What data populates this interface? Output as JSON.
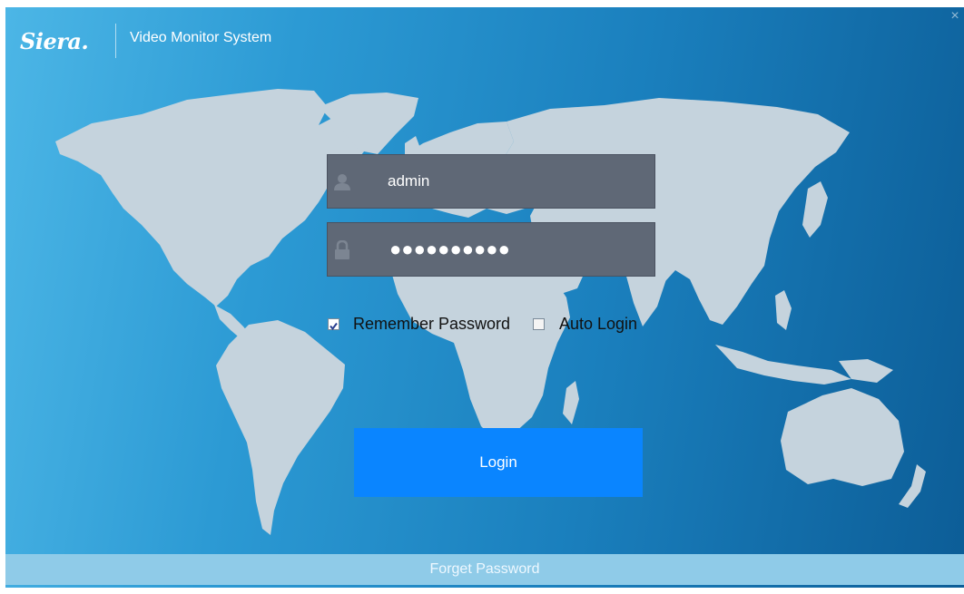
{
  "header": {
    "logo_text": "Siera.",
    "app_title": "Video Monitor System",
    "close_symbol": "×"
  },
  "login_form": {
    "username_value": "admin",
    "username_icon": "user-icon",
    "password_masked": "●●●●●●●●●●",
    "password_icon": "lock-icon",
    "remember_password": {
      "label": "Remember Password",
      "checked": true
    },
    "auto_login": {
      "label": "Auto Login",
      "checked": false
    },
    "login_label": "Login"
  },
  "footer": {
    "forget_password_label": "Forget Password"
  },
  "colors": {
    "accent": "#0a85ff",
    "field_background": "#5f6876",
    "map_land": "#c5d3dd",
    "background_start": "#4cb6e6",
    "background_end": "#0c5d97"
  }
}
